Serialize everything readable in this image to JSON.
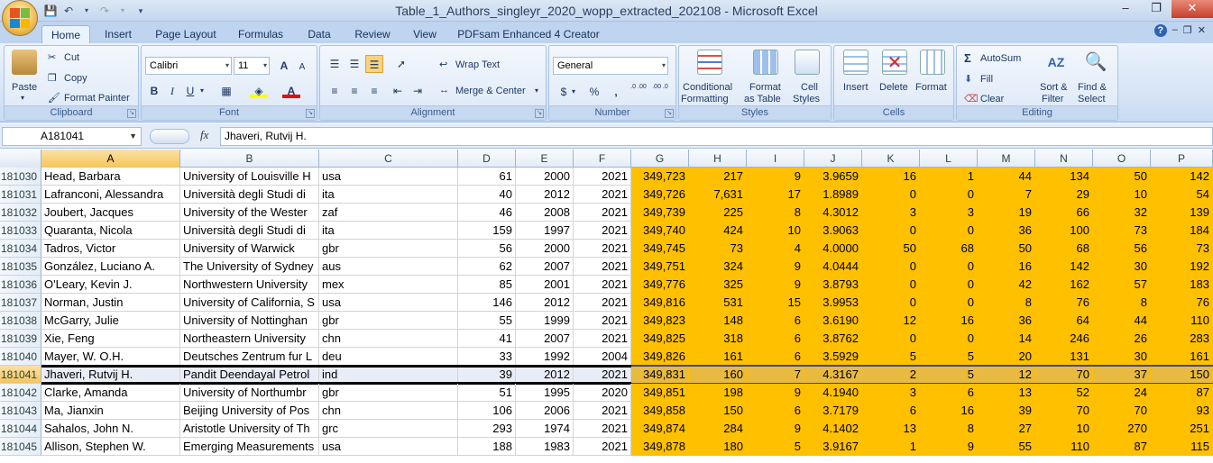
{
  "window": {
    "title": "Table_1_Authors_singleyr_2020_wopp_extracted_202108 - Microsoft Excel"
  },
  "tabs": [
    "Home",
    "Insert",
    "Page Layout",
    "Formulas",
    "Data",
    "Review",
    "View",
    "PDFsam Enhanced 4 Creator"
  ],
  "ribbon": {
    "clipboard": {
      "paste": "Paste",
      "cut": "Cut",
      "copy": "Copy",
      "format_painter": "Format Painter",
      "label": "Clipboard"
    },
    "font": {
      "name": "Calibri",
      "size": "11",
      "bold": "B",
      "italic": "I",
      "underline": "U",
      "grow": "A",
      "shrink": "A",
      "font_color": "A",
      "label": "Font"
    },
    "alignment": {
      "wrap_text": "Wrap Text",
      "merge_center": "Merge & Center",
      "label": "Alignment"
    },
    "number": {
      "format": "General",
      "currency": "$",
      "percent": "%",
      "comma": ",",
      "inc_decimal": ".0 .00",
      "dec_decimal": ".00 .0",
      "label": "Number"
    },
    "styles": {
      "conditional_1": "Conditional",
      "conditional_2": "Formatting",
      "format_table_1": "Format",
      "format_table_2": "as Table",
      "cell_styles_1": "Cell",
      "cell_styles_2": "Styles",
      "label": "Styles"
    },
    "cells": {
      "insert": "Insert",
      "delete": "Delete",
      "format": "Format",
      "label": "Cells"
    },
    "editing": {
      "autosum": "AutoSum",
      "fill": "Fill",
      "clear": "Clear",
      "sort_1": "Sort &",
      "sort_2": "Filter",
      "find_1": "Find &",
      "find_2": "Select",
      "label": "Editing"
    }
  },
  "formula_bar": {
    "name_box": "A181041",
    "fx": "fx",
    "content": "Jhaveri, Rutvij H."
  },
  "columns": [
    "A",
    "B",
    "C",
    "D",
    "E",
    "F",
    "G",
    "H",
    "I",
    "J",
    "K",
    "L",
    "M",
    "N",
    "O",
    "P"
  ],
  "rows": [
    {
      "n": "181030",
      "a": "Head, Barbara",
      "b": "University of Louisville H",
      "c": "usa",
      "d": "61",
      "e": "2000",
      "f": "2021",
      "g": "349,723",
      "h": "217",
      "i": "9",
      "j": "3.9659",
      "k": "16",
      "l": "1",
      "m": "44",
      "nn": "134",
      "o": "50",
      "p": "142"
    },
    {
      "n": "181031",
      "a": "Lafranconi, Alessandra",
      "b": "Università degli Studi di",
      "c": "ita",
      "d": "40",
      "e": "2012",
      "f": "2021",
      "g": "349,726",
      "h": "7,631",
      "i": "17",
      "j": "1.8989",
      "k": "0",
      "l": "0",
      "m": "7",
      "nn": "29",
      "o": "10",
      "p": "54"
    },
    {
      "n": "181032",
      "a": "Joubert, Jacques",
      "b": "University of the Wester",
      "c": "zaf",
      "d": "46",
      "e": "2008",
      "f": "2021",
      "g": "349,739",
      "h": "225",
      "i": "8",
      "j": "4.3012",
      "k": "3",
      "l": "3",
      "m": "19",
      "nn": "66",
      "o": "32",
      "p": "139"
    },
    {
      "n": "181033",
      "a": "Quaranta, Nicola",
      "b": "Università degli Studi di",
      "c": "ita",
      "d": "159",
      "e": "1997",
      "f": "2021",
      "g": "349,740",
      "h": "424",
      "i": "10",
      "j": "3.9063",
      "k": "0",
      "l": "0",
      "m": "36",
      "nn": "100",
      "o": "73",
      "p": "184"
    },
    {
      "n": "181034",
      "a": "Tadros, Victor",
      "b": "University of Warwick",
      "c": "gbr",
      "d": "56",
      "e": "2000",
      "f": "2021",
      "g": "349,745",
      "h": "73",
      "i": "4",
      "j": "4.0000",
      "k": "50",
      "l": "68",
      "m": "50",
      "nn": "68",
      "o": "56",
      "p": "73"
    },
    {
      "n": "181035",
      "a": "González, Luciano A.",
      "b": "The University of Sydney",
      "c": "aus",
      "d": "62",
      "e": "2007",
      "f": "2021",
      "g": "349,751",
      "h": "324",
      "i": "9",
      "j": "4.0444",
      "k": "0",
      "l": "0",
      "m": "16",
      "nn": "142",
      "o": "30",
      "p": "192"
    },
    {
      "n": "181036",
      "a": "O'Leary, Kevin J.",
      "b": "Northwestern University",
      "c": "mex",
      "d": "85",
      "e": "2001",
      "f": "2021",
      "g": "349,776",
      "h": "325",
      "i": "9",
      "j": "3.8793",
      "k": "0",
      "l": "0",
      "m": "42",
      "nn": "162",
      "o": "57",
      "p": "183"
    },
    {
      "n": "181037",
      "a": "Norman, Justin",
      "b": "University of California, S",
      "c": "usa",
      "d": "146",
      "e": "2012",
      "f": "2021",
      "g": "349,816",
      "h": "531",
      "i": "15",
      "j": "3.9953",
      "k": "0",
      "l": "0",
      "m": "8",
      "nn": "76",
      "o": "8",
      "p": "76"
    },
    {
      "n": "181038",
      "a": "McGarry, Julie",
      "b": "University of Nottinghan",
      "c": "gbr",
      "d": "55",
      "e": "1999",
      "f": "2021",
      "g": "349,823",
      "h": "148",
      "i": "6",
      "j": "3.6190",
      "k": "12",
      "l": "16",
      "m": "36",
      "nn": "64",
      "o": "44",
      "p": "110"
    },
    {
      "n": "181039",
      "a": "Xie, Feng",
      "b": "Northeastern University",
      "c": "chn",
      "d": "41",
      "e": "2007",
      "f": "2021",
      "g": "349,825",
      "h": "318",
      "i": "6",
      "j": "3.8762",
      "k": "0",
      "l": "0",
      "m": "14",
      "nn": "246",
      "o": "26",
      "p": "283"
    },
    {
      "n": "181040",
      "a": "Mayer, W. O.H.",
      "b": "Deutsches Zentrum fur L",
      "c": "deu",
      "d": "33",
      "e": "1992",
      "f": "2004",
      "g": "349,826",
      "h": "161",
      "i": "6",
      "j": "3.5929",
      "k": "5",
      "l": "5",
      "m": "20",
      "nn": "131",
      "o": "30",
      "p": "161"
    },
    {
      "n": "181041",
      "a": "Jhaveri, Rutvij H.",
      "b": "Pandit Deendayal Petrol",
      "c": "ind",
      "d": "39",
      "e": "2012",
      "f": "2021",
      "g": "349,831",
      "h": "160",
      "i": "7",
      "j": "4.3167",
      "k": "2",
      "l": "5",
      "m": "12",
      "nn": "70",
      "o": "37",
      "p": "150"
    },
    {
      "n": "181042",
      "a": "Clarke, Amanda",
      "b": "University of Northumbr",
      "c": "gbr",
      "d": "51",
      "e": "1995",
      "f": "2020",
      "g": "349,851",
      "h": "198",
      "i": "9",
      "j": "4.1940",
      "k": "3",
      "l": "6",
      "m": "13",
      "nn": "52",
      "o": "24",
      "p": "87"
    },
    {
      "n": "181043",
      "a": "Ma, Jianxin",
      "b": "Beijing University of Pos",
      "c": "chn",
      "d": "106",
      "e": "2006",
      "f": "2021",
      "g": "349,858",
      "h": "150",
      "i": "6",
      "j": "3.7179",
      "k": "6",
      "l": "16",
      "m": "39",
      "nn": "70",
      "o": "70",
      "p": "93"
    },
    {
      "n": "181044",
      "a": "Sahalos, John N.",
      "b": "Aristotle University of Th",
      "c": "grc",
      "d": "293",
      "e": "1974",
      "f": "2021",
      "g": "349,874",
      "h": "284",
      "i": "9",
      "j": "4.1402",
      "k": "13",
      "l": "8",
      "m": "27",
      "nn": "10",
      "o": "270",
      "p": "251"
    },
    {
      "n": "181045",
      "a": "Allison, Stephen W.",
      "b": "Emerging Measurements",
      "c": "usa",
      "d": "188",
      "e": "1983",
      "f": "2021",
      "g": "349,878",
      "h": "180",
      "i": "5",
      "j": "3.9167",
      "k": "1",
      "l": "9",
      "m": "55",
      "nn": "110",
      "o": "87",
      "p": "115"
    }
  ],
  "colors": {
    "highlight": "#ffc000",
    "ribbon": "#dce8f7",
    "selection": "#2e4aa0"
  },
  "selected_row": "181041"
}
